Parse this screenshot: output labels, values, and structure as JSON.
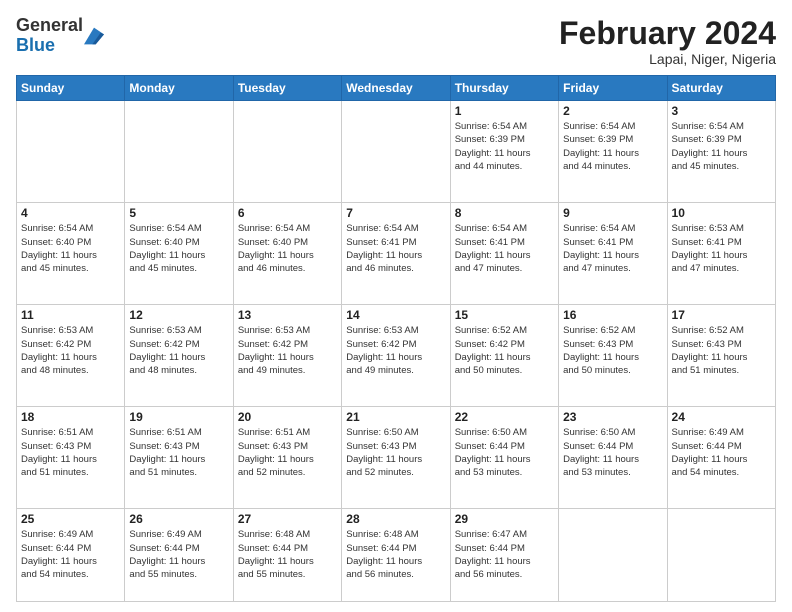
{
  "header": {
    "logo_general": "General",
    "logo_blue": "Blue",
    "month_title": "February 2024",
    "location": "Lapai, Niger, Nigeria"
  },
  "days_of_week": [
    "Sunday",
    "Monday",
    "Tuesday",
    "Wednesday",
    "Thursday",
    "Friday",
    "Saturday"
  ],
  "weeks": [
    [
      {
        "day": "",
        "info": ""
      },
      {
        "day": "",
        "info": ""
      },
      {
        "day": "",
        "info": ""
      },
      {
        "day": "",
        "info": ""
      },
      {
        "day": "1",
        "info": "Sunrise: 6:54 AM\nSunset: 6:39 PM\nDaylight: 11 hours\nand 44 minutes."
      },
      {
        "day": "2",
        "info": "Sunrise: 6:54 AM\nSunset: 6:39 PM\nDaylight: 11 hours\nand 44 minutes."
      },
      {
        "day": "3",
        "info": "Sunrise: 6:54 AM\nSunset: 6:39 PM\nDaylight: 11 hours\nand 45 minutes."
      }
    ],
    [
      {
        "day": "4",
        "info": "Sunrise: 6:54 AM\nSunset: 6:40 PM\nDaylight: 11 hours\nand 45 minutes."
      },
      {
        "day": "5",
        "info": "Sunrise: 6:54 AM\nSunset: 6:40 PM\nDaylight: 11 hours\nand 45 minutes."
      },
      {
        "day": "6",
        "info": "Sunrise: 6:54 AM\nSunset: 6:40 PM\nDaylight: 11 hours\nand 46 minutes."
      },
      {
        "day": "7",
        "info": "Sunrise: 6:54 AM\nSunset: 6:41 PM\nDaylight: 11 hours\nand 46 minutes."
      },
      {
        "day": "8",
        "info": "Sunrise: 6:54 AM\nSunset: 6:41 PM\nDaylight: 11 hours\nand 47 minutes."
      },
      {
        "day": "9",
        "info": "Sunrise: 6:54 AM\nSunset: 6:41 PM\nDaylight: 11 hours\nand 47 minutes."
      },
      {
        "day": "10",
        "info": "Sunrise: 6:53 AM\nSunset: 6:41 PM\nDaylight: 11 hours\nand 47 minutes."
      }
    ],
    [
      {
        "day": "11",
        "info": "Sunrise: 6:53 AM\nSunset: 6:42 PM\nDaylight: 11 hours\nand 48 minutes."
      },
      {
        "day": "12",
        "info": "Sunrise: 6:53 AM\nSunset: 6:42 PM\nDaylight: 11 hours\nand 48 minutes."
      },
      {
        "day": "13",
        "info": "Sunrise: 6:53 AM\nSunset: 6:42 PM\nDaylight: 11 hours\nand 49 minutes."
      },
      {
        "day": "14",
        "info": "Sunrise: 6:53 AM\nSunset: 6:42 PM\nDaylight: 11 hours\nand 49 minutes."
      },
      {
        "day": "15",
        "info": "Sunrise: 6:52 AM\nSunset: 6:42 PM\nDaylight: 11 hours\nand 50 minutes."
      },
      {
        "day": "16",
        "info": "Sunrise: 6:52 AM\nSunset: 6:43 PM\nDaylight: 11 hours\nand 50 minutes."
      },
      {
        "day": "17",
        "info": "Sunrise: 6:52 AM\nSunset: 6:43 PM\nDaylight: 11 hours\nand 51 minutes."
      }
    ],
    [
      {
        "day": "18",
        "info": "Sunrise: 6:51 AM\nSunset: 6:43 PM\nDaylight: 11 hours\nand 51 minutes."
      },
      {
        "day": "19",
        "info": "Sunrise: 6:51 AM\nSunset: 6:43 PM\nDaylight: 11 hours\nand 51 minutes."
      },
      {
        "day": "20",
        "info": "Sunrise: 6:51 AM\nSunset: 6:43 PM\nDaylight: 11 hours\nand 52 minutes."
      },
      {
        "day": "21",
        "info": "Sunrise: 6:50 AM\nSunset: 6:43 PM\nDaylight: 11 hours\nand 52 minutes."
      },
      {
        "day": "22",
        "info": "Sunrise: 6:50 AM\nSunset: 6:44 PM\nDaylight: 11 hours\nand 53 minutes."
      },
      {
        "day": "23",
        "info": "Sunrise: 6:50 AM\nSunset: 6:44 PM\nDaylight: 11 hours\nand 53 minutes."
      },
      {
        "day": "24",
        "info": "Sunrise: 6:49 AM\nSunset: 6:44 PM\nDaylight: 11 hours\nand 54 minutes."
      }
    ],
    [
      {
        "day": "25",
        "info": "Sunrise: 6:49 AM\nSunset: 6:44 PM\nDaylight: 11 hours\nand 54 minutes."
      },
      {
        "day": "26",
        "info": "Sunrise: 6:49 AM\nSunset: 6:44 PM\nDaylight: 11 hours\nand 55 minutes."
      },
      {
        "day": "27",
        "info": "Sunrise: 6:48 AM\nSunset: 6:44 PM\nDaylight: 11 hours\nand 55 minutes."
      },
      {
        "day": "28",
        "info": "Sunrise: 6:48 AM\nSunset: 6:44 PM\nDaylight: 11 hours\nand 56 minutes."
      },
      {
        "day": "29",
        "info": "Sunrise: 6:47 AM\nSunset: 6:44 PM\nDaylight: 11 hours\nand 56 minutes."
      },
      {
        "day": "",
        "info": ""
      },
      {
        "day": "",
        "info": ""
      }
    ]
  ]
}
